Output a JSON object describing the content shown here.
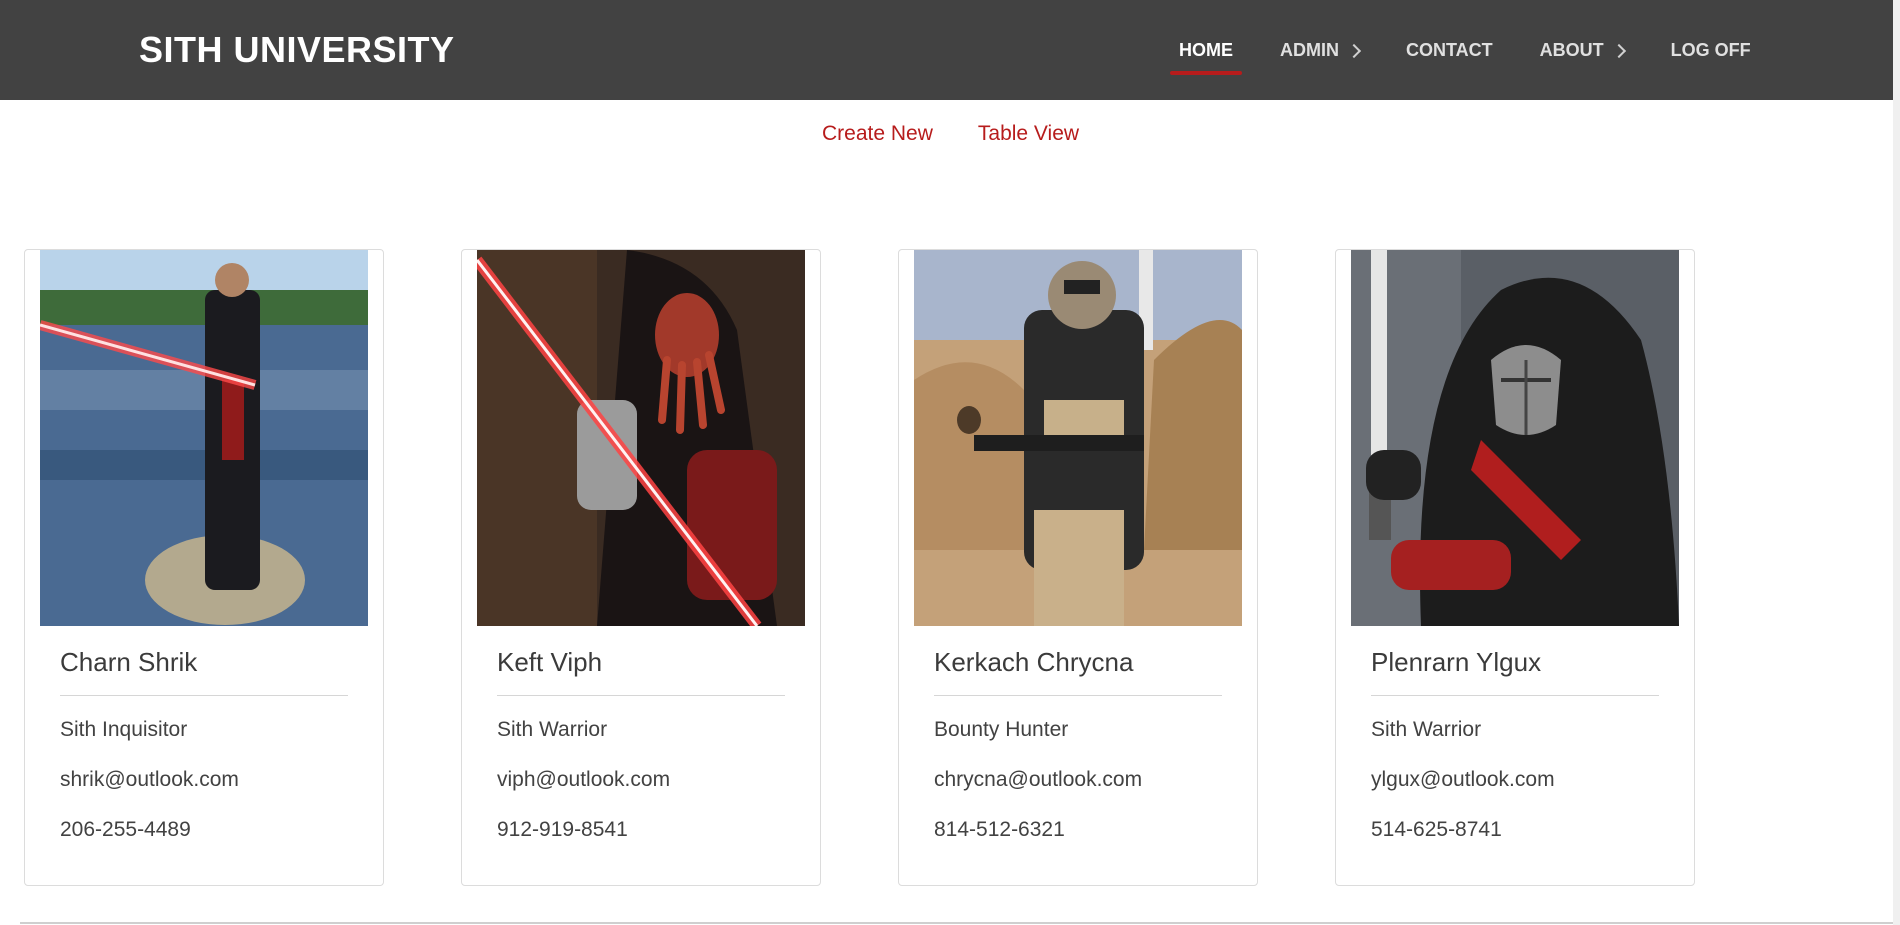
{
  "header": {
    "brand": "SITH UNIVERSITY",
    "nav": [
      {
        "label": "HOME",
        "active": true
      },
      {
        "label": "ADMIN",
        "has_submenu": true
      },
      {
        "label": "CONTACT"
      },
      {
        "label": "ABOUT",
        "has_submenu": true
      },
      {
        "label": "LOG OFF"
      }
    ]
  },
  "actions": {
    "create_new": "Create New",
    "table_view": "Table View"
  },
  "cards": [
    {
      "name": "Charn Shrik",
      "title": "Sith Inquisitor",
      "email": "shrik@outlook.com",
      "phone": "206-255-4489",
      "image_icon": "sith-inquisitor-photo"
    },
    {
      "name": "Keft Viph",
      "title": "Sith Warrior",
      "email": "viph@outlook.com",
      "phone": "912-919-8541",
      "image_icon": "sith-warrior-photo"
    },
    {
      "name": "Kerkach Chrycna",
      "title": "Bounty Hunter",
      "email": "chrycna@outlook.com",
      "phone": "814-512-6321",
      "image_icon": "bounty-hunter-photo"
    },
    {
      "name": "Plenrarn Ylgux",
      "title": "Sith Warrior",
      "email": "ylgux@outlook.com",
      "phone": "514-625-8741",
      "image_icon": "hooded-sith-photo"
    }
  ],
  "colors": {
    "navbar_bg": "#424242",
    "accent": "#b71c1c",
    "text": "#3b3b3b"
  }
}
